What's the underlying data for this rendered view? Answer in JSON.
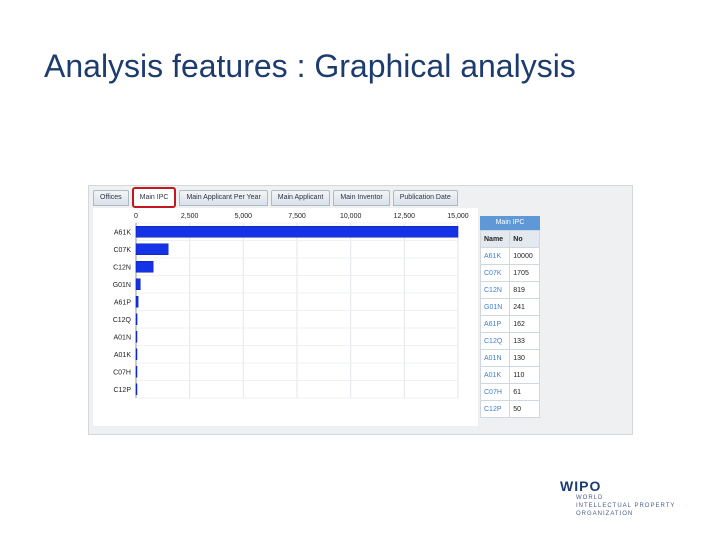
{
  "slide": {
    "title": "Analysis features : Graphical analysis"
  },
  "tabs": [
    {
      "label": "Offices",
      "active": false
    },
    {
      "label": "Main IPC",
      "active": true
    },
    {
      "label": "Main Applicant Per Year",
      "active": false
    },
    {
      "label": "Main Applicant",
      "active": false
    },
    {
      "label": "Main Inventor",
      "active": false
    },
    {
      "label": "Publication Date",
      "active": false
    }
  ],
  "chart_data": {
    "type": "bar",
    "orientation": "horizontal",
    "categories": [
      "A61K",
      "C07K",
      "C12N",
      "G01N",
      "A61P",
      "C12Q",
      "A01N",
      "A01K",
      "C07H",
      "C12P"
    ],
    "values": [
      15000,
      1500,
      800,
      200,
      100,
      50,
      40,
      30,
      10,
      5
    ],
    "xlim": [
      0,
      15000
    ],
    "ticks": [
      "0",
      "2,500",
      "5,000",
      "7,500",
      "10,000",
      "12,500",
      "15,000"
    ],
    "tick_values": [
      0,
      2500,
      5000,
      7500,
      10000,
      12500,
      15000
    ],
    "bar_color": "#1432e6",
    "grid": true
  },
  "table": {
    "title": "Main IPC",
    "headers": [
      "Name",
      "No"
    ],
    "rows": [
      [
        "A61K",
        "10000"
      ],
      [
        "C07K",
        "1705"
      ],
      [
        "C12N",
        "819"
      ],
      [
        "G01N",
        "241"
      ],
      [
        "A61P",
        "162"
      ],
      [
        "C12Q",
        "133"
      ],
      [
        "A01N",
        "130"
      ],
      [
        "A01K",
        "110"
      ],
      [
        "C07H",
        "61"
      ],
      [
        "C12P",
        "50"
      ]
    ]
  },
  "logo": {
    "mark": "WIPO",
    "lines": [
      "WORLD",
      "INTELLECTUAL PROPERTY",
      "ORGANIZATION"
    ]
  }
}
